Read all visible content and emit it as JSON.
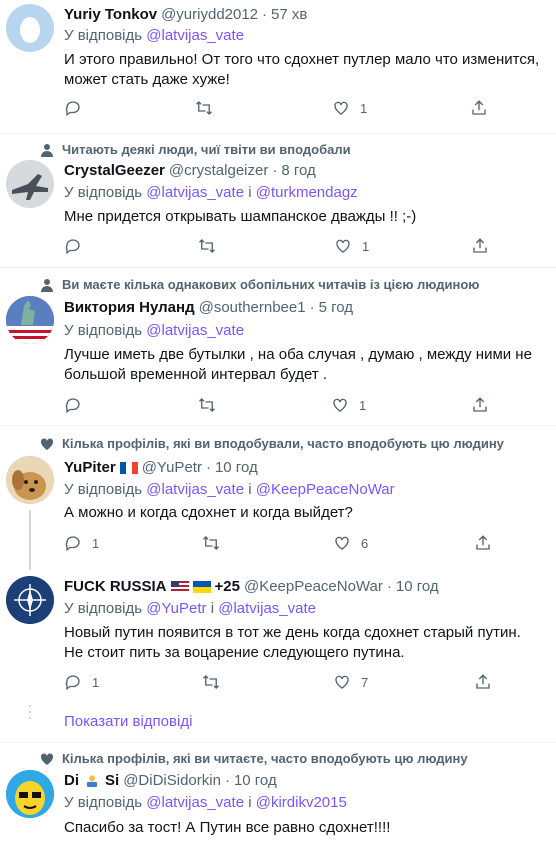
{
  "colors": {
    "accent": "#7856ff",
    "muted": "#536471",
    "text": "#0f1419",
    "divider": "#eff3f4"
  },
  "reply_prefix": "У відповідь",
  "and_word": "і",
  "tweets": [
    {
      "name": "Yuriy Tonkov",
      "handle": "@yuriydd2012",
      "time": "57 хв",
      "mentions": [
        "@latvijas_vate"
      ],
      "text": "И этого правильно! От того что сдохнет путлер мало что изменится, может стать даже хуже!",
      "replies": "",
      "retweets": "",
      "likes": "1",
      "avatar": "egg-avatar"
    },
    {
      "social": "Читають деякі люди, чиї твіти ви вподобали",
      "social_icon": "person-icon",
      "name": "CrystalGeezer",
      "handle": "@crystalgeizer",
      "time": "8 год",
      "mentions": [
        "@latvijas_vate",
        "@turkmendagz"
      ],
      "text": "Мне придется открывать шампанское дважды !! ;-)",
      "replies": "",
      "retweets": "",
      "likes": "1",
      "avatar": "jet-avatar"
    },
    {
      "social": "Ви маєте кілька однакових обопільних читачів із цією людиною",
      "social_icon": "person-icon",
      "name": "Виктория Нуланд",
      "handle": "@southernbee1",
      "time": "5 год",
      "mentions": [
        "@latvijas_vate"
      ],
      "text": "Лучше иметь две бутылки , на оба случая , думаю , между ними не большой временной интервал будет .",
      "replies": "",
      "retweets": "",
      "likes": "1",
      "avatar": "statue-avatar"
    },
    {
      "social": "Кілька профілів, які ви вподобували, часто вподобують цю людину",
      "social_icon": "heart-icon",
      "name": "YuPiter",
      "handle": "@YuPetr",
      "time": "10 год",
      "mentions": [
        "@latvijas_vate",
        "@KeepPeaceNoWar"
      ],
      "text": "А можно и когда сдохнет и когда выйдет?",
      "replies": "1",
      "retweets": "",
      "likes": "6",
      "avatar": "dog-avatar"
    },
    {
      "name": "FUCK RUSSIA",
      "name_suffix": "+25",
      "handle": "@KeepPeaceNoWar",
      "time": "10 год",
      "mentions": [
        "@YuPetr",
        "@latvijas_vate"
      ],
      "text": "Новый путин появится в тот же день когда сдохнет старый путин. Не стоит пить за воцарение следующего путина.",
      "replies": "1",
      "retweets": "",
      "likes": "7",
      "avatar": "nato-avatar"
    },
    {
      "social": "Кілька профілів, які ви читаєте, часто вподобують цю людину",
      "social_icon": "heart-icon",
      "name_a": "Di",
      "name_b": "Si",
      "handle": "@DiDiSidorkin",
      "time": "10 год",
      "mentions": [
        "@latvijas_vate",
        "@kirdikv2015"
      ],
      "text": "Спасибо за тост! А Путин все равно сдохнет!!!!",
      "avatar": "yellow-face-avatar"
    }
  ],
  "show_replies": "Показати відповіді",
  "dot": "·"
}
